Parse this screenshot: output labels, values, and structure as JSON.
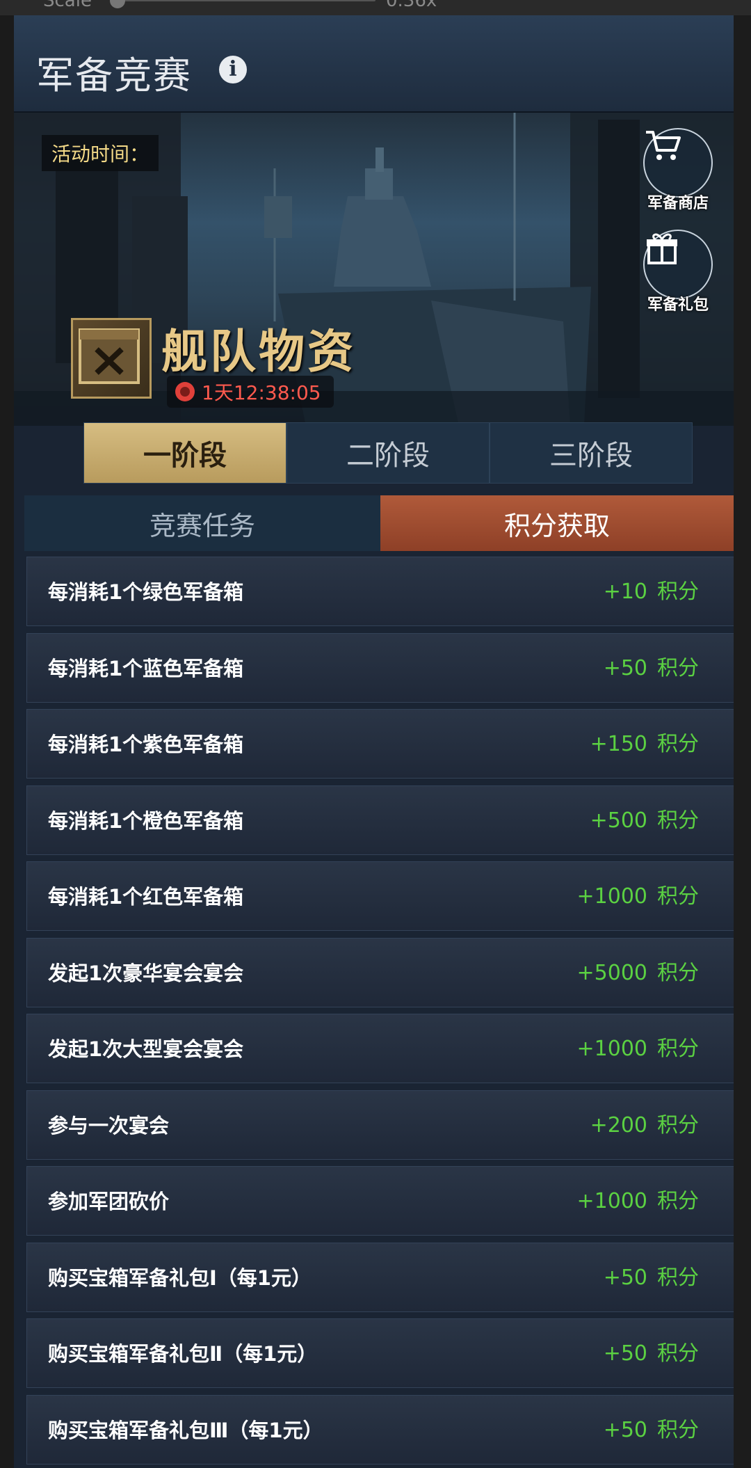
{
  "toolbar": {
    "scale_label": "Scale",
    "scale_value": "0.36x"
  },
  "header": {
    "title": "军备竞赛",
    "info_icon": "info-icon"
  },
  "banner": {
    "time_label": "活动时间：",
    "shop_label": "军备商店",
    "gift_label": "军备礼包",
    "event_name": "舰队物资",
    "timer": "1天12:38:05"
  },
  "stages": [
    {
      "label": "一阶段",
      "active": true
    },
    {
      "label": "二阶段",
      "active": false
    },
    {
      "label": "三阶段",
      "active": false
    }
  ],
  "main_tabs": [
    {
      "label": "竞赛任务",
      "active": false
    },
    {
      "label": "积分获取",
      "active": true
    }
  ],
  "points_unit": "积分",
  "tasks": [
    {
      "desc": "每消耗1个绿色军备箱",
      "points": "+10"
    },
    {
      "desc": "每消耗1个蓝色军备箱",
      "points": "+50"
    },
    {
      "desc": "每消耗1个紫色军备箱",
      "points": "+150"
    },
    {
      "desc": "每消耗1个橙色军备箱",
      "points": "+500"
    },
    {
      "desc": "每消耗1个红色军备箱",
      "points": "+1000"
    },
    {
      "desc": "发起1次豪华宴会宴会",
      "points": "+5000"
    },
    {
      "desc": "发起1次大型宴会宴会",
      "points": "+1000"
    },
    {
      "desc": "参与一次宴会",
      "points": "+200"
    },
    {
      "desc": "参加军团砍价",
      "points": "+1000"
    },
    {
      "desc": "购买宝箱军备礼包Ⅰ（每1元）",
      "points": "+50"
    },
    {
      "desc": "购买宝箱军备礼包Ⅱ（每1元）",
      "points": "+50"
    },
    {
      "desc": "购买宝箱军备礼包Ⅲ（每1元）",
      "points": "+50"
    }
  ],
  "colors": {
    "points_green": "#5bd142",
    "tab_active": "#b05a3a",
    "stage_active": "#d6bd82",
    "timer_red": "#ff5a4e"
  }
}
